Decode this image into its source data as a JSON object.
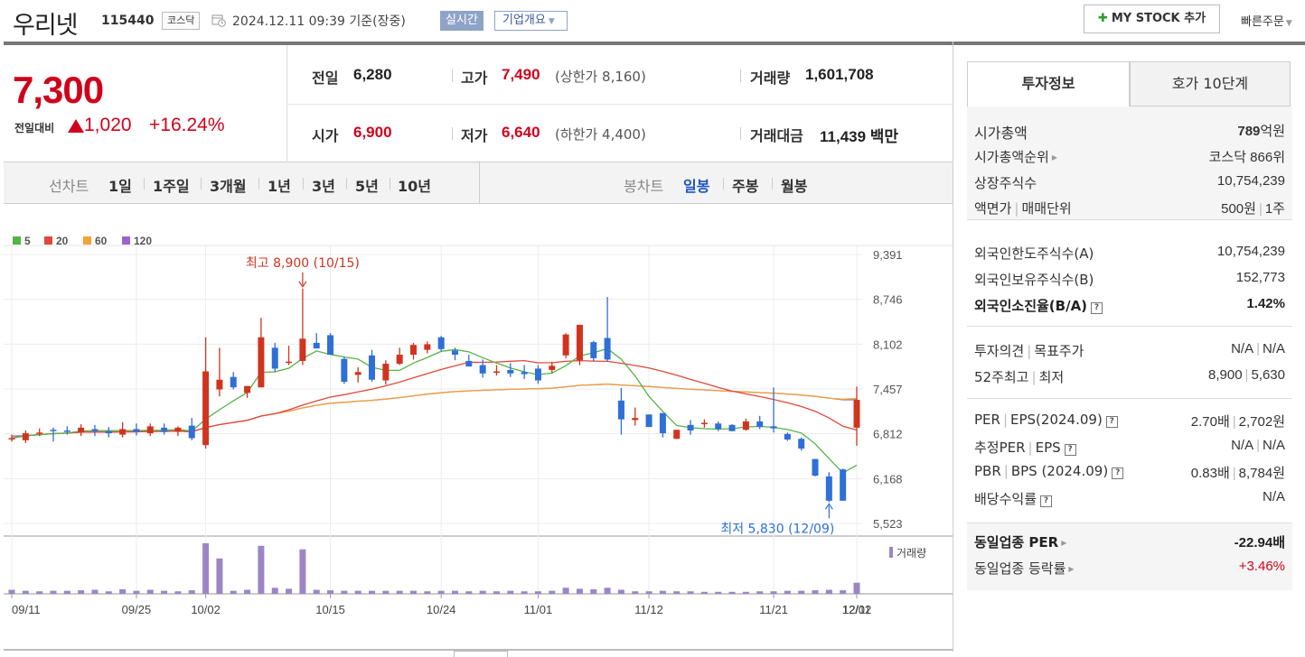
{
  "header": {
    "name": "우리넷",
    "code": "115440",
    "market": "코스닥",
    "timestamp": "2024.12.11 09:39 기준(장중)",
    "live_label": "실시간",
    "company_label": "기업개요",
    "mystock_label": "MY STOCK 추가",
    "quick_order_label": "빠른주문"
  },
  "summary": {
    "price": "7,300",
    "change_label": "전일대비",
    "change": "1,020",
    "change_pct": "+16.24%",
    "prev_close_label": "전일",
    "prev_close": "6,280",
    "high_label": "고가",
    "high": "7,490",
    "upper_limit": "(상한가 8,160)",
    "volume_label": "거래량",
    "volume": "1,601,708",
    "open_label": "시가",
    "open": "6,900",
    "low_label": "저가",
    "low": "6,640",
    "lower_limit": "(하한가 4,400)",
    "amount_label": "거래대금",
    "amount": "11,439 백만"
  },
  "periods": {
    "line_chart_label": "선차트",
    "line_options": [
      "1일",
      "1주일",
      "3개월",
      "1년",
      "3년",
      "5년",
      "10년"
    ],
    "candle_label": "봉차트",
    "candle_options": [
      "일봉",
      "주봉",
      "월봉"
    ],
    "candle_active": "일봉"
  },
  "chart_data": {
    "type": "candlestick",
    "ylim": [
      5523,
      9391
    ],
    "y_ticks": [
      "9,391",
      "8,746",
      "8,102",
      "7,457",
      "6,812",
      "6,168",
      "5,523"
    ],
    "x_ticks": [
      "09/11",
      "09/25",
      "10/02",
      "10/15",
      "10/24",
      "11/01",
      "11/12",
      "11/21",
      "12/02",
      "12/11"
    ],
    "legend": [
      {
        "name": "5",
        "color": "#55b346"
      },
      {
        "name": "20",
        "color": "#e0473a"
      },
      {
        "name": "60",
        "color": "#f0a23b"
      },
      {
        "name": "120",
        "color": "#9a66cc"
      }
    ],
    "volume_label": "거래량",
    "max_annotation": "최고 8,900 (10/15)",
    "min_annotation": "최저 5,830 (12/09)",
    "candles": [
      {
        "o": 6740,
        "h": 6800,
        "l": 6700,
        "c": 6750
      },
      {
        "o": 6720,
        "h": 6860,
        "l": 6680,
        "c": 6820
      },
      {
        "o": 6820,
        "h": 6890,
        "l": 6780,
        "c": 6830
      },
      {
        "o": 6870,
        "h": 6900,
        "l": 6700,
        "c": 6860
      },
      {
        "o": 6860,
        "h": 6920,
        "l": 6800,
        "c": 6850
      },
      {
        "o": 6830,
        "h": 6950,
        "l": 6780,
        "c": 6900
      },
      {
        "o": 6880,
        "h": 6940,
        "l": 6780,
        "c": 6850
      },
      {
        "o": 6850,
        "h": 6910,
        "l": 6760,
        "c": 6820
      },
      {
        "o": 6800,
        "h": 6980,
        "l": 6760,
        "c": 6880
      },
      {
        "o": 6880,
        "h": 6960,
        "l": 6790,
        "c": 6840
      },
      {
        "o": 6820,
        "h": 6960,
        "l": 6780,
        "c": 6920
      },
      {
        "o": 6900,
        "h": 6960,
        "l": 6800,
        "c": 6840
      },
      {
        "o": 6840,
        "h": 6920,
        "l": 6780,
        "c": 6900
      },
      {
        "o": 6930,
        "h": 7040,
        "l": 6720,
        "c": 6750
      },
      {
        "o": 6650,
        "h": 8200,
        "l": 6600,
        "c": 7710
      },
      {
        "o": 7450,
        "h": 8050,
        "l": 7350,
        "c": 7590
      },
      {
        "o": 7630,
        "h": 7700,
        "l": 7450,
        "c": 7480
      },
      {
        "o": 7400,
        "h": 7500,
        "l": 7330,
        "c": 7500
      },
      {
        "o": 7480,
        "h": 8480,
        "l": 7480,
        "c": 8200
      },
      {
        "o": 8050,
        "h": 8120,
        "l": 7700,
        "c": 7750
      },
      {
        "o": 7840,
        "h": 8080,
        "l": 7800,
        "c": 7850
      },
      {
        "o": 7860,
        "h": 8900,
        "l": 7800,
        "c": 8180
      },
      {
        "o": 8120,
        "h": 8260,
        "l": 8050,
        "c": 8040
      },
      {
        "o": 8230,
        "h": 8260,
        "l": 7950,
        "c": 7950
      },
      {
        "o": 7890,
        "h": 7920,
        "l": 7530,
        "c": 7560
      },
      {
        "o": 7660,
        "h": 7770,
        "l": 7550,
        "c": 7700
      },
      {
        "o": 7940,
        "h": 8020,
        "l": 7560,
        "c": 7590
      },
      {
        "o": 7580,
        "h": 7870,
        "l": 7520,
        "c": 7820
      },
      {
        "o": 7820,
        "h": 8050,
        "l": 7800,
        "c": 7950
      },
      {
        "o": 7950,
        "h": 8120,
        "l": 7880,
        "c": 8090
      },
      {
        "o": 8020,
        "h": 8140,
        "l": 7970,
        "c": 8100
      },
      {
        "o": 8200,
        "h": 8220,
        "l": 8000,
        "c": 8030
      },
      {
        "o": 8010,
        "h": 8050,
        "l": 7870,
        "c": 7950
      },
      {
        "o": 7860,
        "h": 7950,
        "l": 7780,
        "c": 7780
      },
      {
        "o": 7800,
        "h": 7880,
        "l": 7620,
        "c": 7680
      },
      {
        "o": 7700,
        "h": 7800,
        "l": 7650,
        "c": 7710
      },
      {
        "o": 7730,
        "h": 7830,
        "l": 7630,
        "c": 7680
      },
      {
        "o": 7700,
        "h": 7800,
        "l": 7600,
        "c": 7670
      },
      {
        "o": 7750,
        "h": 7800,
        "l": 7530,
        "c": 7580
      },
      {
        "o": 7730,
        "h": 7850,
        "l": 7690,
        "c": 7790
      },
      {
        "o": 7940,
        "h": 8260,
        "l": 7900,
        "c": 8240
      },
      {
        "o": 7870,
        "h": 8380,
        "l": 7800,
        "c": 8380
      },
      {
        "o": 8130,
        "h": 8150,
        "l": 7860,
        "c": 7900
      },
      {
        "o": 8190,
        "h": 8780,
        "l": 7860,
        "c": 7880
      },
      {
        "o": 7290,
        "h": 7470,
        "l": 6800,
        "c": 7020
      },
      {
        "o": 7010,
        "h": 7190,
        "l": 6930,
        "c": 7040
      },
      {
        "o": 7090,
        "h": 7090,
        "l": 6980,
        "c": 6910
      },
      {
        "o": 7110,
        "h": 7110,
        "l": 6760,
        "c": 6820
      },
      {
        "o": 6740,
        "h": 6860,
        "l": 6740,
        "c": 6870
      },
      {
        "o": 6940,
        "h": 7010,
        "l": 6800,
        "c": 6860
      },
      {
        "o": 6950,
        "h": 7020,
        "l": 6900,
        "c": 6970
      },
      {
        "o": 6960,
        "h": 6990,
        "l": 6850,
        "c": 6880
      },
      {
        "o": 6940,
        "h": 6950,
        "l": 6850,
        "c": 6850
      },
      {
        "o": 6870,
        "h": 7030,
        "l": 6860,
        "c": 6990
      },
      {
        "o": 6990,
        "h": 7070,
        "l": 6880,
        "c": 6910
      },
      {
        "o": 6920,
        "h": 7480,
        "l": 6830,
        "c": 6890
      },
      {
        "o": 6810,
        "h": 6830,
        "l": 6710,
        "c": 6730
      },
      {
        "o": 6740,
        "h": 6760,
        "l": 6570,
        "c": 6600
      },
      {
        "o": 6450,
        "h": 6450,
        "l": 6200,
        "c": 6210
      },
      {
        "o": 6200,
        "h": 6260,
        "l": 5830,
        "c": 5850
      },
      {
        "o": 6300,
        "h": 6310,
        "l": 5850,
        "c": 5850
      },
      {
        "o": 6900,
        "h": 7490,
        "l": 6640,
        "c": 7300
      }
    ],
    "volumes": [
      8,
      6,
      5,
      6,
      6,
      7,
      8,
      5,
      9,
      6,
      8,
      6,
      5,
      7,
      100,
      70,
      6,
      8,
      95,
      12,
      10,
      88,
      8,
      7,
      6,
      6,
      6,
      6,
      6,
      6,
      5,
      6,
      6,
      5,
      6,
      5,
      6,
      5,
      5,
      6,
      12,
      10,
      9,
      12,
      8,
      5,
      5,
      6,
      5,
      5,
      4,
      4,
      4,
      4,
      5,
      5,
      6,
      6,
      7,
      8,
      7,
      22
    ]
  },
  "invest": {
    "tab_active": "투자정보",
    "tab_other": "호가 10단계",
    "market_cap_label": "시가총액",
    "market_cap_num": "789",
    "market_cap_unit": "억원",
    "market_cap_rank_label": "시가총액순위",
    "market_cap_rank": "코스닥 866위",
    "listed_shares_label": "상장주식수",
    "listed_shares": "10,754,239",
    "par_label": "액면가",
    "unit_label": "매매단위",
    "par_value": "500원",
    "trade_unit": "1주",
    "foreign_limit_label": "외국인한도주식수(A)",
    "foreign_limit": "10,754,239",
    "foreign_hold_label": "외국인보유주식수(B)",
    "foreign_hold": "152,773",
    "foreign_ratio_label": "외국인소진율(B/A)",
    "foreign_ratio": "1.42%",
    "opinion_label": "투자의견",
    "target_label": "목표주가",
    "opinion": "N/A",
    "target": "N/A",
    "high52_label": "52주최고",
    "low52_label": "최저",
    "high52": "8,900",
    "low52": "5,630",
    "per_label": "PER",
    "eps_label": "EPS(2024.09)",
    "per": "2.70배",
    "eps": "2,702원",
    "est_per_label": "추정PER",
    "est_eps_label": "EPS",
    "est_per": "N/A",
    "est_eps": "N/A",
    "pbr_label": "PBR",
    "bps_label": "BPS (2024.09)",
    "pbr": "0.83배",
    "bps": "8,784원",
    "dividend_label": "배당수익률",
    "dividend": "N/A",
    "sector_per_label": "동일업종 PER",
    "sector_per": "-22.94배",
    "sector_change_label": "동일업종 등락률",
    "sector_change": "+3.46%"
  }
}
